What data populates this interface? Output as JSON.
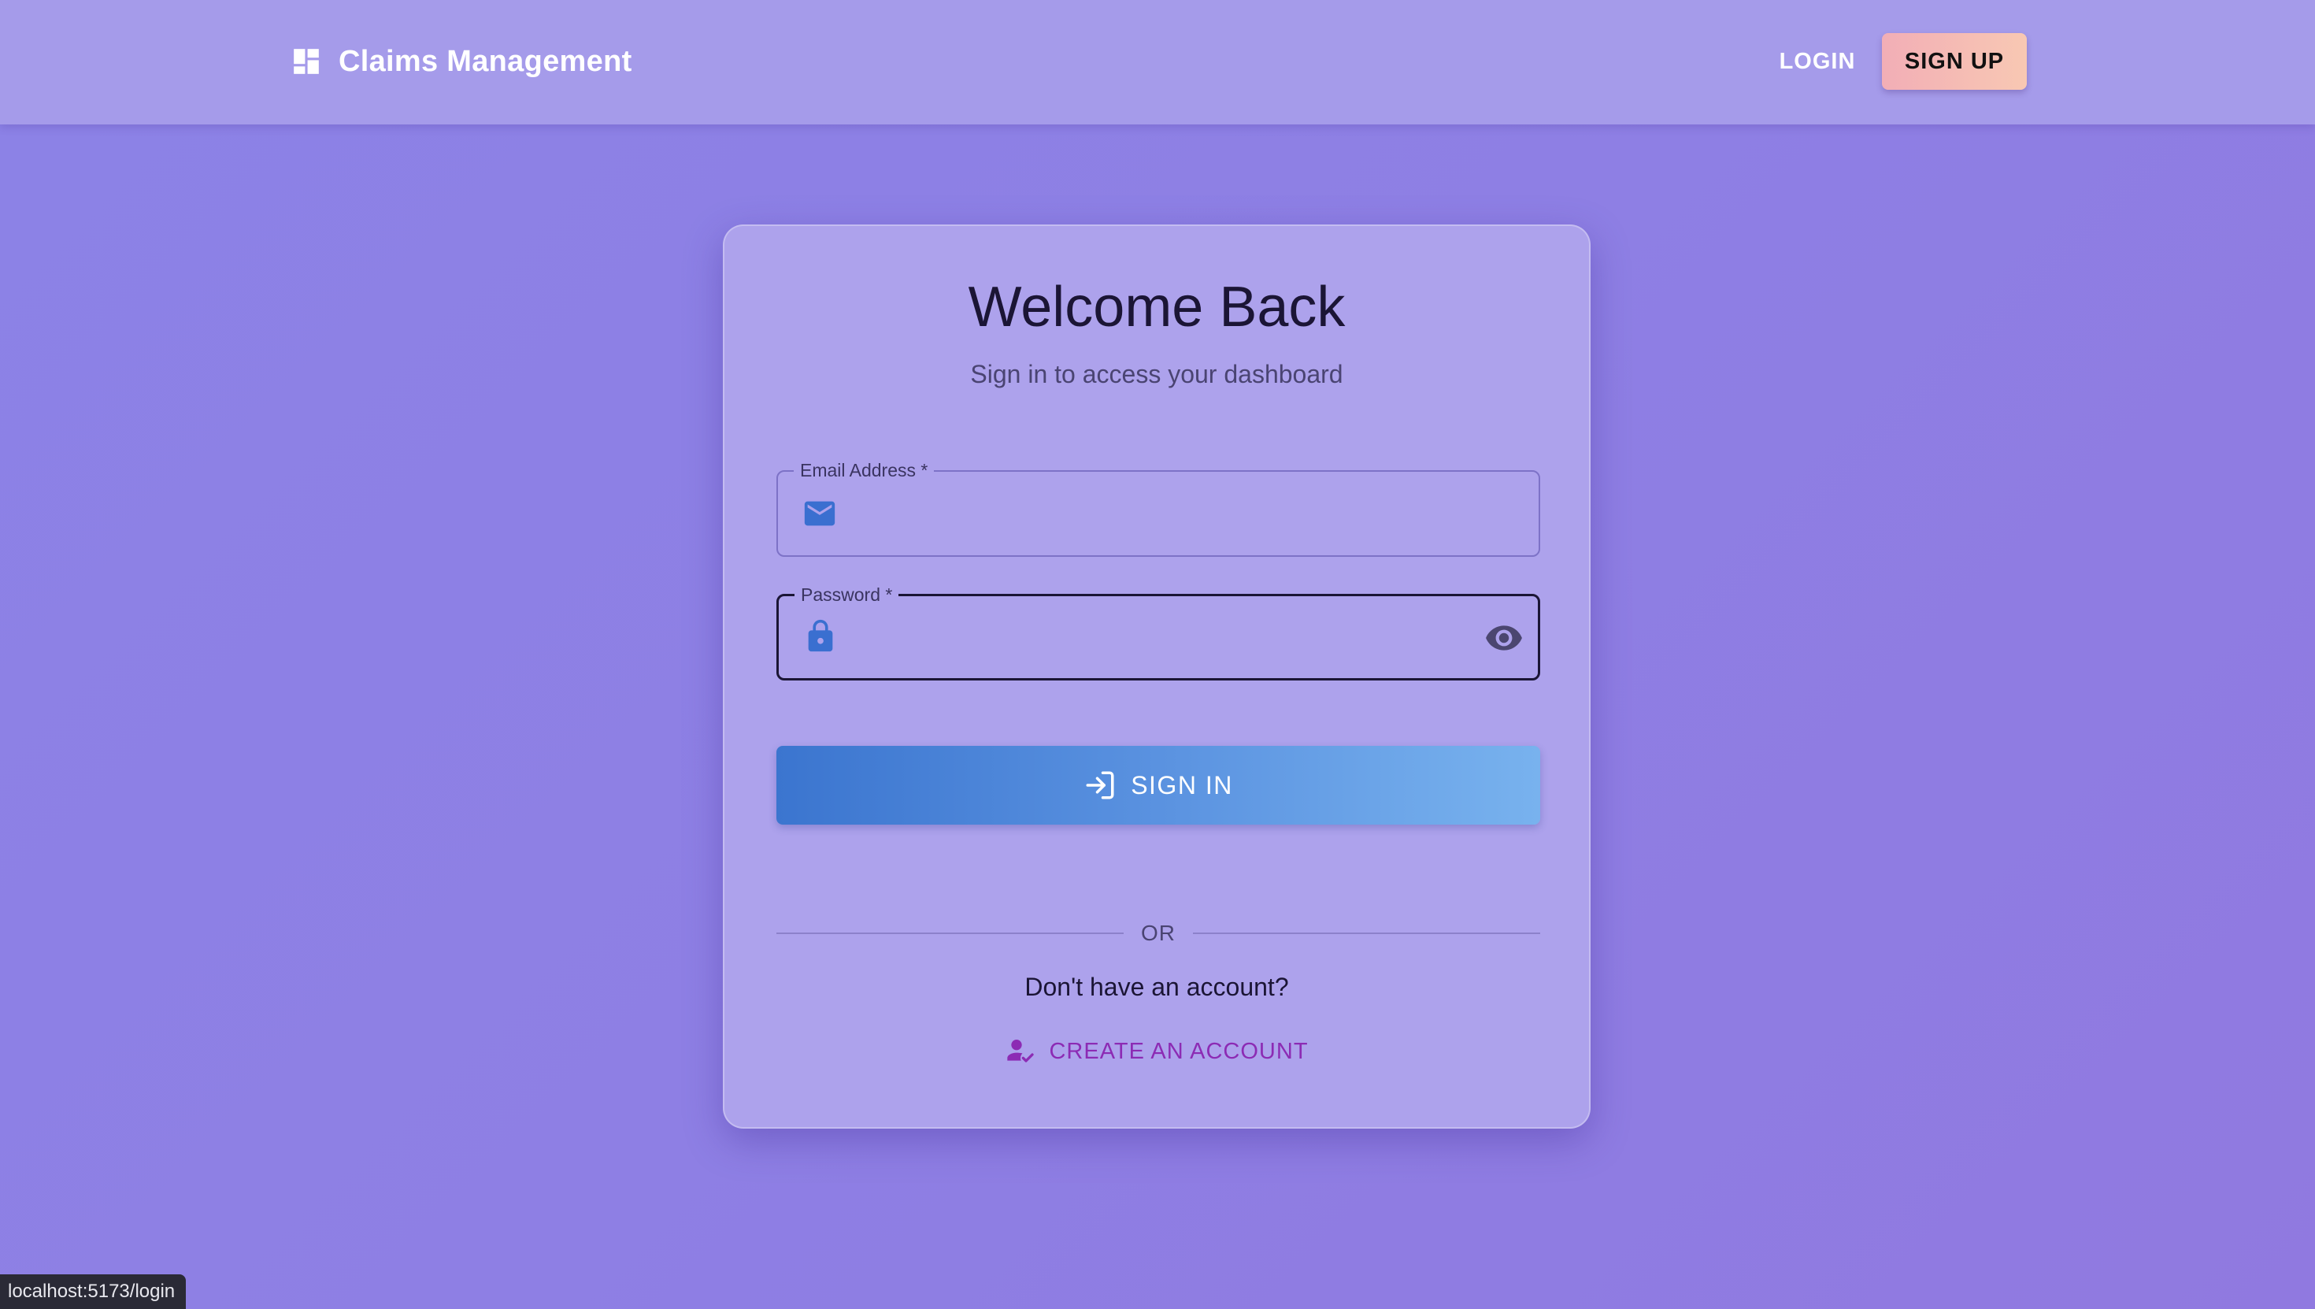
{
  "app": {
    "title": "Claims Management",
    "icon": "dashboard-icon"
  },
  "nav": {
    "login_label": "LOGIN",
    "signup_label": "SIGN UP"
  },
  "login_card": {
    "title": "Welcome Back",
    "subtitle": "Sign in to access your dashboard",
    "email": {
      "label": "Email Address *",
      "value": "",
      "placeholder": "",
      "icon": "email-icon"
    },
    "password": {
      "label": "Password *",
      "value": "",
      "placeholder": "",
      "icon": "lock-icon",
      "toggle_icon": "eye-icon",
      "focused": true
    },
    "signin_label": "SIGN IN",
    "signin_icon": "login-icon",
    "divider_text": "OR",
    "no_account_text": "Don't have an account?",
    "create_account_label": "CREATE AN ACCOUNT",
    "create_account_icon": "person-check-icon"
  },
  "status_bar": {
    "url": "localhost:5173/login"
  },
  "colors": {
    "background": "#8e7fe4",
    "appbar": "#a59bea",
    "card": "#ada2ec",
    "signin_gradient_start": "#3b75cf",
    "signin_gradient_end": "#78b2ee",
    "signup_gradient_start": "#f2aeb6",
    "signup_gradient_end": "#f8c8b3",
    "link": "#8c2bb4",
    "field_icon": "#3a6fd0"
  }
}
